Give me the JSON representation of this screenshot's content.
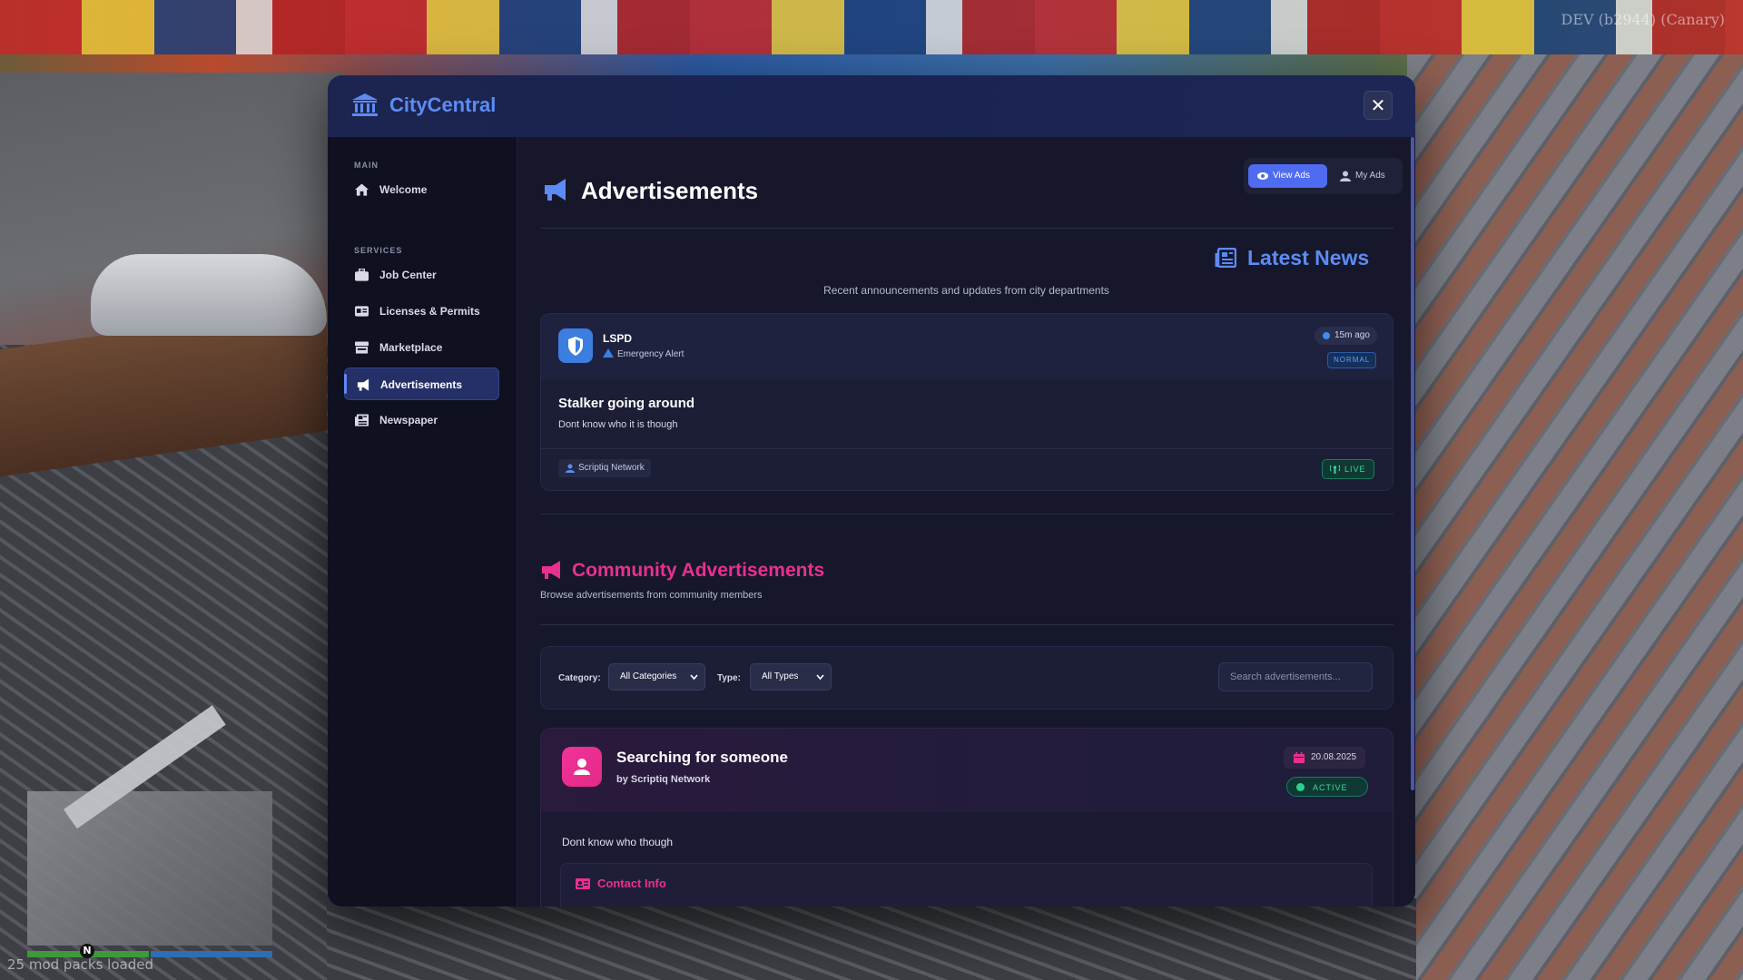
{
  "hud": {
    "build_text": "DEV (b2944) (Canary)",
    "mod_status": "25 mod packs loaded",
    "minimap_north": "N"
  },
  "app": {
    "title": "CityCentral",
    "brand_color": "#5d8bf4",
    "close_icon": "close-icon"
  },
  "sidebar": {
    "sections": [
      {
        "label": "MAIN",
        "items": [
          {
            "label": "Welcome",
            "icon": "home-icon"
          }
        ]
      },
      {
        "label": "SERVICES",
        "items": [
          {
            "label": "Job Center",
            "icon": "briefcase-icon"
          },
          {
            "label": "Licenses & Permits",
            "icon": "id-card-icon"
          },
          {
            "label": "Marketplace",
            "icon": "store-icon"
          },
          {
            "label": "Advertisements",
            "icon": "megaphone-icon",
            "active": true
          },
          {
            "label": "Newspaper",
            "icon": "newspaper-icon"
          }
        ]
      }
    ]
  },
  "page": {
    "title": "Advertisements",
    "tabs": [
      {
        "label": "View Ads",
        "icon": "eye-icon",
        "active": true
      },
      {
        "label": "My Ads",
        "icon": "user-icon",
        "active": false
      }
    ]
  },
  "news": {
    "title": "Latest News",
    "subtitle": "Recent announcements and updates from city departments",
    "items": [
      {
        "org": "LSPD",
        "type": "Emergency Alert",
        "time": "15m ago",
        "priority": "NORMAL",
        "title": "Stalker going around",
        "body": "Dont know who it is though",
        "author": "Scriptiq Network",
        "live_label": "LIVE"
      }
    ]
  },
  "community": {
    "title": "Community Advertisements",
    "subtitle": "Browse advertisements from community members",
    "accent_color": "#e9308f",
    "filters": {
      "category_label": "Category:",
      "category_value": "All Categories",
      "type_label": "Type:",
      "type_value": "All Types",
      "search_placeholder": "Search advertisements..."
    },
    "ads": [
      {
        "title": "Searching for someone",
        "author": "by Scriptiq Network",
        "date": "20.08.2025",
        "status": "ACTIVE",
        "description": "Dont know who though",
        "contact_label": "Contact Info"
      }
    ]
  }
}
